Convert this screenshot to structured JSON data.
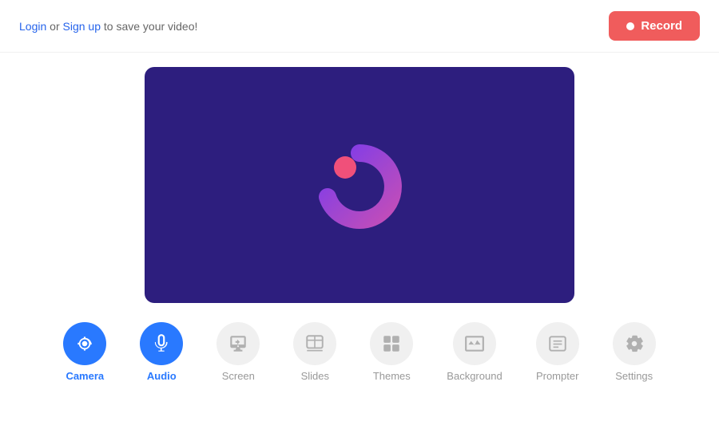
{
  "header": {
    "login_text": "Login",
    "or_text": " or ",
    "signup_text": "Sign up",
    "save_text": " to save your video!",
    "record_label": "Record"
  },
  "toolbar": {
    "items": [
      {
        "id": "camera",
        "label": "Camera",
        "active": true,
        "color": "blue"
      },
      {
        "id": "audio",
        "label": "Audio",
        "active": true,
        "color": "blue"
      },
      {
        "id": "screen",
        "label": "Screen",
        "active": false,
        "color": "gray"
      },
      {
        "id": "slides",
        "label": "Slides",
        "active": false,
        "color": "gray"
      },
      {
        "id": "themes",
        "label": "Themes",
        "active": false,
        "color": "gray"
      },
      {
        "id": "background",
        "label": "Background",
        "active": false,
        "color": "gray"
      },
      {
        "id": "prompter",
        "label": "Prompter",
        "active": false,
        "color": "gray"
      },
      {
        "id": "settings",
        "label": "Settings",
        "active": false,
        "color": "gray"
      }
    ]
  },
  "colors": {
    "accent_blue": "#2979ff",
    "record_red": "#f05c5c",
    "video_bg": "#2d1e7e",
    "icon_gray": "#b0b0b0",
    "icon_bg_inactive": "#f0f0f0"
  }
}
